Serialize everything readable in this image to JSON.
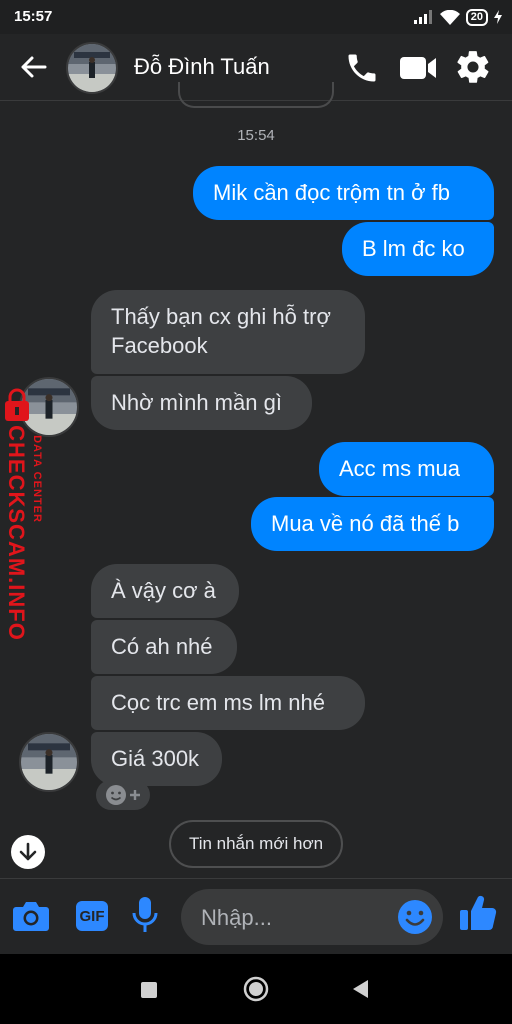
{
  "status_bar": {
    "time": "15:57",
    "battery": "20"
  },
  "header": {
    "contact_name": "Đỗ Đình Tuấn"
  },
  "chat": {
    "timestamp": "15:54",
    "sent_group_1": [
      "Mik cần đọc trộm tn ở fb",
      "B lm đc ko"
    ],
    "received_group_1": [
      "Thấy bạn cx ghi hỗ trợ\nFacebook",
      "Nhờ mình mần gì"
    ],
    "sent_group_2": [
      "Acc ms mua",
      "Mua về nó đã thế b"
    ],
    "received_group_2": [
      "À vậy cơ à",
      "Có ah nhé",
      "Cọc trc em ms lm nhé",
      "Giá 300k"
    ],
    "newer_messages_button": "Tin nhắn mới hơn"
  },
  "composer": {
    "placeholder": "Nhập...",
    "gif_label": "GIF"
  },
  "watermark": {
    "main": "CHECKSCAM.INFO",
    "sub": "DATA CENTER"
  },
  "colors": {
    "accent": "#0084ff",
    "bubble_received": "#3e4042",
    "background": "#242526",
    "watermark": "#e0151b"
  },
  "icons": [
    "back-arrow-icon",
    "phone-icon",
    "video-camera-icon",
    "gear-icon",
    "camera-icon",
    "gif-icon",
    "microphone-icon",
    "emoji-icon",
    "thumbs-up-icon",
    "arrow-down-icon",
    "lock-icon"
  ]
}
